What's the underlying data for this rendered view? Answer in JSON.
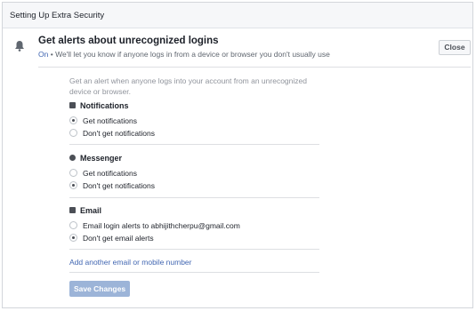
{
  "header": {
    "title": "Setting Up Extra Security"
  },
  "alert": {
    "title": "Get alerts about unrecognized logins",
    "status": "On",
    "separator": "•",
    "subtitle": "We'll let you know if anyone logs in from a device or browser you don't usually use",
    "close_label": "Close"
  },
  "description": "Get an alert when anyone logs into your account from an unrecognized device or browser.",
  "sections": [
    {
      "title": "Notifications",
      "icon": "facebook-icon",
      "options": [
        {
          "label": "Get notifications",
          "checked": true
        },
        {
          "label": "Don't get notifications",
          "checked": false
        }
      ]
    },
    {
      "title": "Messenger",
      "icon": "messenger-icon",
      "options": [
        {
          "label": "Get notifications",
          "checked": false
        },
        {
          "label": "Don't get notifications",
          "checked": true
        }
      ]
    },
    {
      "title": "Email",
      "icon": "email-icon",
      "options": [
        {
          "label": "Email login alerts to abhijithcherpu@gmail.com",
          "checked": false
        },
        {
          "label": "Don't get email alerts",
          "checked": true
        }
      ]
    }
  ],
  "add_link": "Add another email or mobile number",
  "save_label": "Save Changes",
  "colors": {
    "link": "#4267b2",
    "save_disabled": "#9cb4d8",
    "header_bg": "#f6f7f9"
  }
}
